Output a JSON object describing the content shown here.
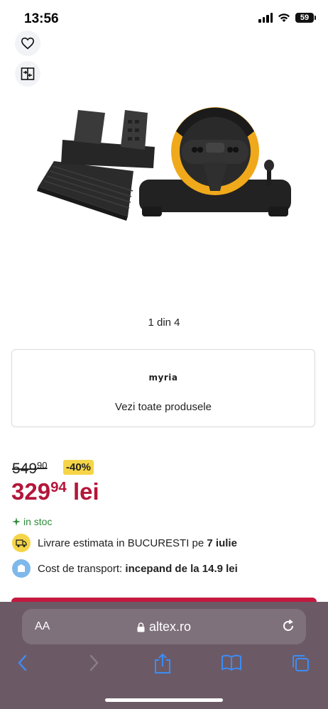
{
  "status_bar": {
    "time": "13:56",
    "battery": "59",
    "icons": [
      "signal-icon",
      "wifi-icon",
      "battery-icon"
    ]
  },
  "actions": {
    "favorite_icon": "heart-icon",
    "compare_icon": "compare-icon"
  },
  "gallery": {
    "counter": "1 din 4",
    "image": "product-image-steering-wheel-and-pedals"
  },
  "brand": {
    "logo_text": "myria",
    "link": "Vezi toate produsele"
  },
  "price": {
    "old_int": "549",
    "old_dec": "90",
    "discount": "-40%",
    "new_int": "329",
    "new_dec": "94",
    "currency": "lei"
  },
  "stock": {
    "icon": "sparkle-icon",
    "text": "in stoc"
  },
  "delivery": {
    "icon": "truck-icon",
    "text": "Livrare estimata in BUCURESTI pe ",
    "date": "7 iulie"
  },
  "transport": {
    "icon": "box-icon",
    "label": "Cost de transport: ",
    "value": "incepand de la 14.9 lei"
  },
  "browser": {
    "text_size": "AA",
    "url": "altex.ro",
    "toolbar": [
      "back-icon",
      "forward-icon",
      "share-icon",
      "bookmarks-icon",
      "tabs-icon"
    ]
  },
  "colors": {
    "price_red": "#b3163a",
    "discount_yellow": "#f5d447",
    "stock_green": "#2e8b3a",
    "safari_bar": "#6b5a66"
  }
}
